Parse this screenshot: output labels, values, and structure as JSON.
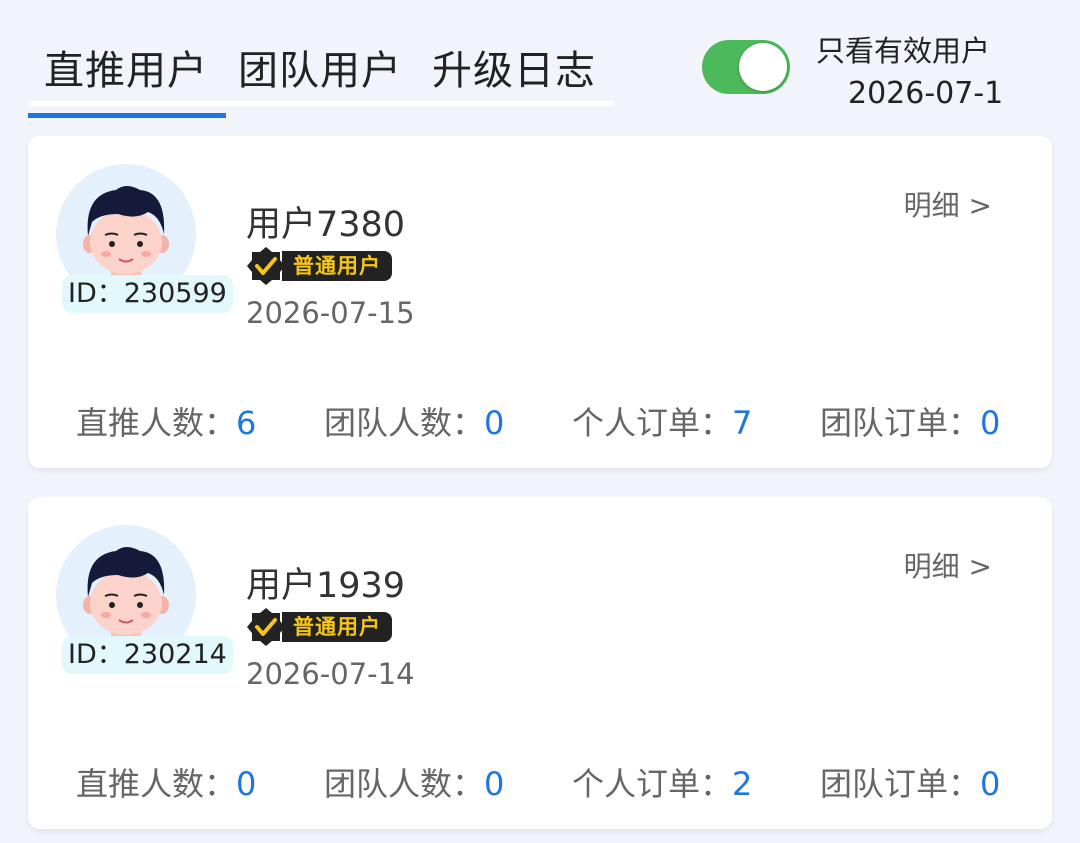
{
  "tabs": [
    {
      "label": "直推用户",
      "active": true
    },
    {
      "label": "团队用户",
      "active": false
    },
    {
      "label": "升级日志",
      "active": false
    }
  ],
  "filter": {
    "label": "只看有效用户",
    "enabled": true,
    "date": "2026-07-1"
  },
  "colors": {
    "accent": "#1e77e0",
    "toggle_on": "#4cba5a",
    "badge_bg": "#222222",
    "badge_text": "#f5c518"
  },
  "cards": [
    {
      "avatar_icon": "cartoon-boy-avatar-icon",
      "id_label": "ID：230599",
      "name": "用户7380",
      "level": "普通用户",
      "date": "2026-07-15",
      "detail_label": "明细 >",
      "stats": [
        {
          "label": "直推人数：",
          "value": "6"
        },
        {
          "label": "团队人数：",
          "value": "0"
        },
        {
          "label": "个人订单：",
          "value": "7"
        },
        {
          "label": "团队订单：",
          "value": "0"
        }
      ]
    },
    {
      "avatar_icon": "cartoon-boy-avatar-icon",
      "id_label": "ID：230214",
      "name": "用户1939",
      "level": "普通用户",
      "date": "2026-07-14",
      "detail_label": "明细 >",
      "stats": [
        {
          "label": "直推人数：",
          "value": "0"
        },
        {
          "label": "团队人数：",
          "value": "0"
        },
        {
          "label": "个人订单：",
          "value": "2"
        },
        {
          "label": "团队订单：",
          "value": "0"
        }
      ]
    }
  ]
}
